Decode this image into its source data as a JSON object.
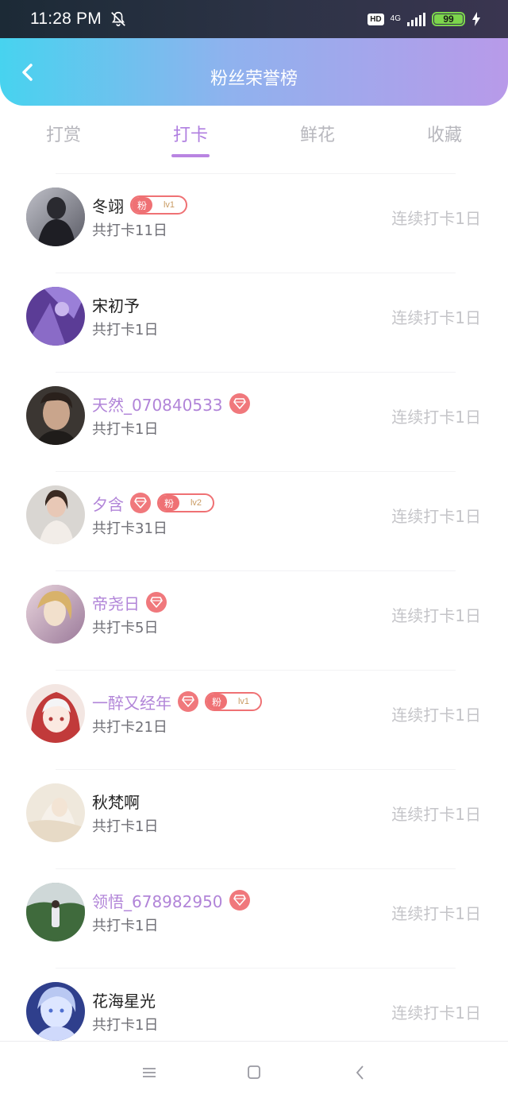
{
  "status": {
    "time": "11:28 PM",
    "hd": "HD",
    "network": "4G",
    "battery": "99"
  },
  "header": {
    "title": "粉丝荣誉榜"
  },
  "tabs": [
    "打赏",
    "打卡",
    "鲜花",
    "收藏"
  ],
  "active_tab": "打卡",
  "colors": {
    "header_gradient_start": "#47d3ef",
    "header_gradient_end": "#b89ae9",
    "accent": "#b07fe0",
    "badge_red": "#ef7174",
    "vip_name": "#b184d8"
  },
  "list": [
    {
      "name": "冬翊",
      "vip": false,
      "diamond": false,
      "fan_char": "粉",
      "fan_lv": "lv1",
      "total": "共打卡11日",
      "streak": "连续打卡1日",
      "avatar": "avatar-dark-figure"
    },
    {
      "name": "宋初予",
      "vip": false,
      "diamond": false,
      "fan_char": "",
      "fan_lv": "",
      "total": "共打卡1日",
      "streak": "连续打卡1日",
      "avatar": "avatar-purple-scene"
    },
    {
      "name": "天然_070840533",
      "vip": true,
      "diamond": true,
      "fan_char": "",
      "fan_lv": "",
      "total": "共打卡1日",
      "streak": "连续打卡1日",
      "avatar": "avatar-man-portrait"
    },
    {
      "name": "夕含",
      "vip": true,
      "diamond": true,
      "fan_char": "粉",
      "fan_lv": "lv2",
      "total": "共打卡31日",
      "streak": "连续打卡1日",
      "avatar": "avatar-girl-photo"
    },
    {
      "name": "帝尧日",
      "vip": true,
      "diamond": true,
      "fan_char": "",
      "fan_lv": "",
      "total": "共打卡5日",
      "streak": "连续打卡1日",
      "avatar": "avatar-painted-figure"
    },
    {
      "name": "一醉又经年",
      "vip": true,
      "diamond": true,
      "fan_char": "粉",
      "fan_lv": "lv1",
      "total": "共打卡21日",
      "streak": "连续打卡1日",
      "avatar": "avatar-anime-hood"
    },
    {
      "name": "秋梵啊",
      "vip": false,
      "diamond": false,
      "fan_char": "",
      "fan_lv": "",
      "total": "共打卡1日",
      "streak": "连续打卡1日",
      "avatar": "avatar-pale-illustration"
    },
    {
      "name": "领悟_678982950",
      "vip": true,
      "diamond": true,
      "fan_char": "",
      "fan_lv": "",
      "total": "共打卡1日",
      "streak": "连续打卡1日",
      "avatar": "avatar-outdoor-photo"
    },
    {
      "name": "花海星光",
      "vip": false,
      "diamond": false,
      "fan_char": "",
      "fan_lv": "",
      "total": "共打卡1日",
      "streak": "连续打卡1日",
      "avatar": "avatar-anime-blue"
    }
  ]
}
